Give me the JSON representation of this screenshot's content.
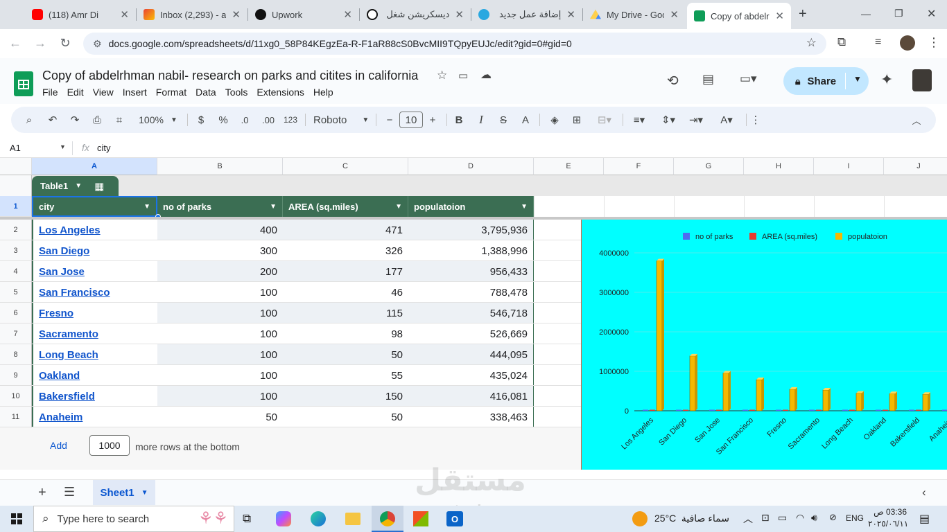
{
  "browser": {
    "tabs": [
      {
        "label": "(118) Amr Di",
        "icon": "youtube-icon",
        "color": "#ff0000"
      },
      {
        "label": "Inbox (2,293) - a",
        "icon": "gmail-icon",
        "color": "#ea4335"
      },
      {
        "label": "Upwork",
        "icon": "upwork-icon",
        "color": "#111111"
      },
      {
        "label": "ديسكريشن شغل",
        "icon": "chatgpt-icon",
        "color": "#111111"
      },
      {
        "label": "إضافة عمل جديد",
        "icon": "mostaql-icon",
        "color": "#2aa8e0"
      },
      {
        "label": "My Drive - Goog",
        "icon": "drive-icon",
        "color": "#1fa463"
      },
      {
        "label": "Copy of abdelrh",
        "icon": "sheets-icon",
        "color": "#0f9d58"
      }
    ],
    "new_tab": "+",
    "url": "docs.google.com/spreadsheets/d/11xg0_58P84KEgzEa-R-F1aR88cS0BvcMII9TQpyEUJc/edit?gid=0#gid=0"
  },
  "doc": {
    "title": "Copy of abdelrhman nabil- research on parks and citites in california",
    "menu": [
      "File",
      "Edit",
      "View",
      "Insert",
      "Format",
      "Data",
      "Tools",
      "Extensions",
      "Help"
    ],
    "share_label": "Share"
  },
  "toolbar": {
    "zoom": "100%",
    "currency": "$",
    "percent": "%",
    "dec_decrease": ".0",
    "dec_increase": ".00",
    "format_123": "123",
    "font": "Roboto",
    "font_size": "10",
    "bold": "B",
    "italic": "I",
    "strike": "S",
    "text_color": "A"
  },
  "formula_bar": {
    "cell_ref": "A1",
    "fx": "fx",
    "content": "city"
  },
  "grid": {
    "columns": [
      "A",
      "B",
      "C",
      "D",
      "E",
      "F",
      "G",
      "H",
      "I",
      "J"
    ],
    "table_name": "Table1",
    "headers": [
      "city",
      "no of parks",
      "AREA (sq.miles)",
      "populatoion"
    ],
    "rows": [
      {
        "n": "2",
        "city": "Los Angeles",
        "parks": "400",
        "area": "471",
        "pop": "3,795,936"
      },
      {
        "n": "3",
        "city": "San Diego",
        "parks": "300",
        "area": "326",
        "pop": "1,388,996"
      },
      {
        "n": "4",
        "city": "San Jose",
        "parks": "200",
        "area": "177",
        "pop": "956,433"
      },
      {
        "n": "5",
        "city": "San Francisco",
        "parks": "100",
        "area": "46",
        "pop": "788,478"
      },
      {
        "n": "6",
        "city": "Fresno",
        "parks": "100",
        "area": "115",
        "pop": "546,718"
      },
      {
        "n": "7",
        "city": "Sacramento",
        "parks": "100",
        "area": "98",
        "pop": "526,669"
      },
      {
        "n": "8",
        "city": "Long Beach",
        "parks": "100",
        "area": "50",
        "pop": "444,095"
      },
      {
        "n": "9",
        "city": "Oakland",
        "parks": "100",
        "area": "55",
        "pop": "435,024"
      },
      {
        "n": "10",
        "city": "Bakersfield",
        "parks": "100",
        "area": "150",
        "pop": "416,081"
      },
      {
        "n": "11",
        "city": "Anaheim",
        "parks": "50",
        "area": "50",
        "pop": "338,463"
      }
    ],
    "header_row_num": "1",
    "add_label": "Add",
    "add_rows_value": "1000",
    "add_rows_suffix": "more rows at the bottom"
  },
  "chart_data": {
    "type": "bar",
    "background": "#00ffff",
    "categories": [
      "Los Angeles",
      "San Diego",
      "San Jose",
      "San Francisco",
      "Fresno",
      "Sacramento",
      "Long Beach",
      "Oakland",
      "Bakersfield",
      "Anaheim"
    ],
    "series": [
      {
        "name": "no of parks",
        "color": "#4f6cf0",
        "values": [
          400,
          300,
          200,
          100,
          100,
          100,
          100,
          100,
          100,
          50
        ]
      },
      {
        "name": "AREA (sq.miles)",
        "color": "#e63b2e",
        "values": [
          471,
          326,
          177,
          46,
          115,
          98,
          50,
          55,
          150,
          50
        ]
      },
      {
        "name": "populatoion",
        "color": "#f5b800",
        "values": [
          3795936,
          1388996,
          956433,
          788478,
          546718,
          526669,
          444095,
          435024,
          416081,
          338463
        ]
      }
    ],
    "yticks": [
      "0",
      "1000000",
      "2000000",
      "3000000",
      "4000000"
    ],
    "ylim": [
      0,
      4000000
    ],
    "legend": "top"
  },
  "sheets": {
    "tab_label": "Sheet1"
  },
  "taskbar": {
    "search_placeholder": "Type here to search",
    "weather_temp": "25°C",
    "weather_desc": "سماء صافية",
    "lang": "ENG",
    "time": "03:36 ص",
    "date": "٢٠٢٥/٠٦/١١"
  },
  "watermark": {
    "text": "مستقل",
    "sub": "mostaql.com"
  }
}
